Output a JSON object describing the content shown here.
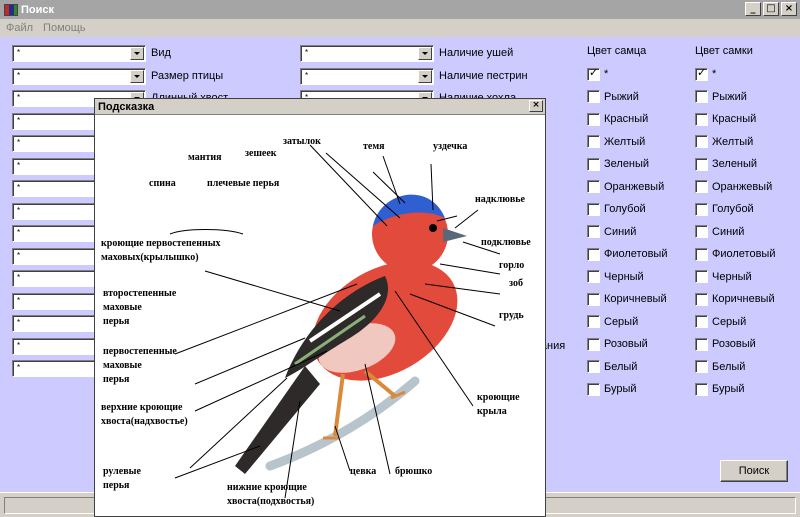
{
  "window": {
    "title": "Поиск",
    "min": "_",
    "max": "□",
    "close": "×"
  },
  "menu": [
    "Файл",
    "Помощь"
  ],
  "left_fields": [
    {
      "value": "*",
      "label": "Вид"
    },
    {
      "value": "*",
      "label": "Размер птицы"
    },
    {
      "value": "*",
      "label": "Длинный хвост"
    },
    {
      "value": "*",
      "label": ""
    },
    {
      "value": "*",
      "label": ""
    },
    {
      "value": "*",
      "label": ""
    },
    {
      "value": "*",
      "label": ""
    },
    {
      "value": "*",
      "label": ""
    },
    {
      "value": "*",
      "label": ""
    },
    {
      "value": "*",
      "label": ""
    },
    {
      "value": "*",
      "label": ""
    },
    {
      "value": "*",
      "label": ""
    },
    {
      "value": "*",
      "label": ""
    },
    {
      "value": "*",
      "label": ""
    },
    {
      "value": "*",
      "label": ""
    }
  ],
  "mid_fields": [
    {
      "value": "*",
      "label": "Наличие ушей"
    },
    {
      "value": "*",
      "label": "Наличие пестрин"
    },
    {
      "value": "*",
      "label": "Наличие хохла"
    }
  ],
  "mid_partial_label": "тания",
  "male_color": {
    "header": "Цвет самца",
    "options": [
      {
        "label": "*",
        "checked": true
      },
      {
        "label": "Рыжий",
        "checked": false
      },
      {
        "label": "Красный",
        "checked": false
      },
      {
        "label": "Желтый",
        "checked": false
      },
      {
        "label": "Зеленый",
        "checked": false
      },
      {
        "label": "Оранжевый",
        "checked": false
      },
      {
        "label": "Голубой",
        "checked": false
      },
      {
        "label": "Синий",
        "checked": false
      },
      {
        "label": "Фиолетовый",
        "checked": false
      },
      {
        "label": "Черный",
        "checked": false
      },
      {
        "label": "Коричневый",
        "checked": false
      },
      {
        "label": "Серый",
        "checked": false
      },
      {
        "label": "Розовый",
        "checked": false
      },
      {
        "label": "Белый",
        "checked": false
      },
      {
        "label": "Бурый",
        "checked": false
      }
    ]
  },
  "female_color": {
    "header": "Цвет самки",
    "options": [
      {
        "label": "*",
        "checked": true
      },
      {
        "label": "Рыжий",
        "checked": false
      },
      {
        "label": "Красный",
        "checked": false
      },
      {
        "label": "Желтый",
        "checked": false
      },
      {
        "label": "Зеленый",
        "checked": false
      },
      {
        "label": "Оранжевый",
        "checked": false
      },
      {
        "label": "Голубой",
        "checked": false
      },
      {
        "label": "Синий",
        "checked": false
      },
      {
        "label": "Фиолетовый",
        "checked": false
      },
      {
        "label": "Черный",
        "checked": false
      },
      {
        "label": "Коричневый",
        "checked": false
      },
      {
        "label": "Серый",
        "checked": false
      },
      {
        "label": "Розовый",
        "checked": false
      },
      {
        "label": "Белый",
        "checked": false
      },
      {
        "label": "Бурый",
        "checked": false
      }
    ]
  },
  "search_button": "Поиск",
  "hint": {
    "title": "Подсказка",
    "close": "×",
    "labels": {
      "mantiya": "мантия",
      "spina": "спина",
      "plechevye": "плечевые перья",
      "zasheek": "зешеек",
      "zatylok": "затылок",
      "temya": "темя",
      "uzdechka": "уздечка",
      "nadklyuve": "надклювье",
      "podklyuve": "подклювье",
      "gorlo": "горло",
      "zob": "зоб",
      "grud": "грудь",
      "kroyushie_krylа": "кроющие крыла",
      "kroyushie_perv_1": "кроющие первостепенных",
      "kroyushie_perv_2": "маховых(крылышко)",
      "vtor_1": "второстепенные",
      "vtor_2": "маховые",
      "vtor_3": "перья",
      "perv_1": "первостепенные",
      "perv_2": "маховые",
      "perv_3": "перья",
      "verhnie_1": "верхние кроющие",
      "verhnie_2": "хвоста(надхвостье)",
      "rulevye_1": "рулевые",
      "rulevye_2": "перья",
      "nizhnie_1": "нижние кроющие",
      "nizhnie_2": "хвоста(подхвостья)",
      "cevka": "цевка",
      "bryushko": "брюшко"
    }
  },
  "colors": {
    "client_bg": "#cccaff",
    "bird_red": "#e24a3c",
    "bird_blue": "#2f5fd0",
    "bird_dark": "#2e2a2a"
  }
}
